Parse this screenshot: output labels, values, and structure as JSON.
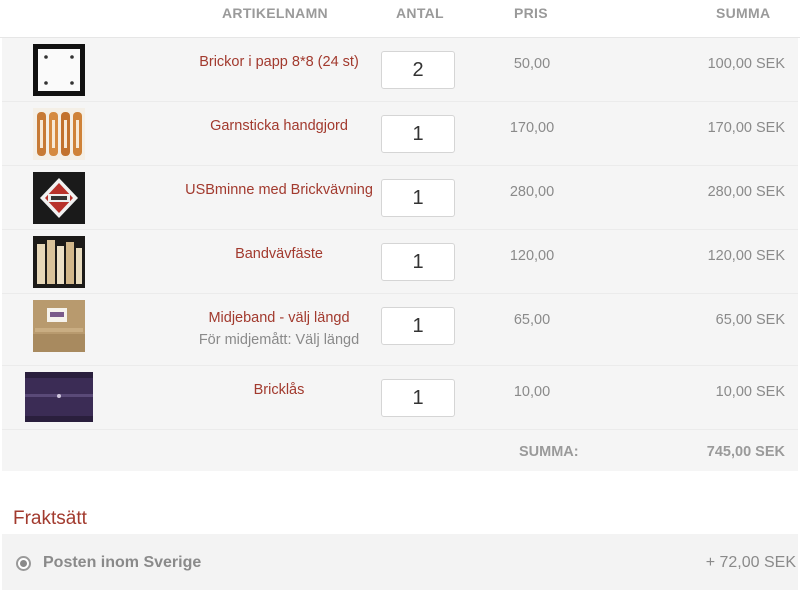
{
  "cart": {
    "headers": {
      "name": "ARTIKELNAMN",
      "qty": "ANTAL",
      "price": "PRIS",
      "sum": "SUMMA"
    },
    "items": [
      {
        "name": "Brickor i papp 8*8 (24 st)",
        "qty": "2",
        "price": "50,00",
        "sum": "100,00 SEK",
        "image": "white-cardboard-tablet-thumbnail"
      },
      {
        "name": "Garnsticka handgjord",
        "qty": "1",
        "price": "170,00",
        "sum": "170,00 SEK",
        "image": "wooden-shuttles-thumbnail"
      },
      {
        "name": "USBminne med Brickvävning",
        "qty": "1",
        "price": "280,00",
        "sum": "280,00 SEK",
        "image": "usb-stick-thumbnail"
      },
      {
        "name": "Bandvävfäste",
        "qty": "1",
        "price": "120,00",
        "sum": "120,00 SEK",
        "image": "band-loom-holder-thumbnail"
      },
      {
        "name": "Midjeband - välj längd",
        "variant": "För midjemått: Välj längd",
        "qty": "1",
        "price": "65,00",
        "sum": "65,00 SEK",
        "image": "waistband-thumbnail"
      },
      {
        "name": "Bricklås",
        "qty": "1",
        "price": "10,00",
        "sum": "10,00 SEK",
        "image": "tablet-lock-thumbnail"
      }
    ],
    "total_label": "SUMMA:",
    "total_value": "745,00 SEK"
  },
  "shipping": {
    "title": "Fraktsätt",
    "options": [
      {
        "label": "Posten inom Sverige",
        "price": "+ 72,00 SEK",
        "selected": true
      }
    ]
  },
  "colors": {
    "link": "#a23a2e",
    "text": "#8a8a8a",
    "row_bg": "#f5f5f5"
  }
}
